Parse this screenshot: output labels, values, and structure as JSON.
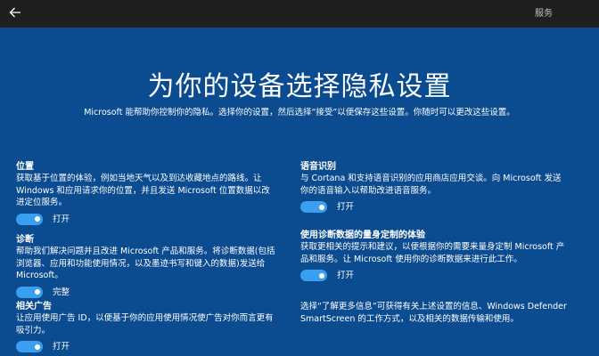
{
  "titlebar": {
    "back_icon": "back-arrow-icon",
    "service_label": "服务"
  },
  "header": {
    "title": "为你的设备选择隐私设置",
    "subtitle": "Microsoft 能帮助你控制你的隐私。选择你的设置，然后选择“接受”以便保存这些设置。你随时可以更改这些设置。"
  },
  "left": [
    {
      "title": "位置",
      "desc": "获取基于位置的体验，例如当地天气以及到达收藏地点的路线。让 Windows 和应用请求你的位置，并且发送 Microsoft 位置数据以改进定位服务。",
      "toggle_label": "打开",
      "on": true
    },
    {
      "title": "诊断",
      "desc": "帮助我们解决问题并且改进 Microsoft 产品和服务。将诊断数据(包括浏览器、应用和功能使用情况，以及墨迹书写和键入的数据)发送给 Microsoft。",
      "toggle_label": "完整",
      "on": true
    },
    {
      "title": "相关广告",
      "desc": "让应用使用广告 ID，以便基于你的应用使用情况使广告对你而言更有吸引力。",
      "toggle_label": "打开",
      "on": true
    }
  ],
  "right": [
    {
      "title": "语音识别",
      "desc": "与 Cortana 和支持语音识别的应用商店应用交谈。向 Microsoft 发送你的语音输入以帮助改进语音服务。",
      "toggle_label": "打开",
      "on": true
    },
    {
      "title": "使用诊断数据的量身定制的体验",
      "desc": "获取更相关的提示和建议，以便根据你的需要来量身定制 Microsoft 产品和服务。让 Microsoft 使用你的诊断数据来进行此工作。",
      "toggle_label": "打开",
      "on": true
    }
  ],
  "footer_note": "选择“了解更多信息”可获得有关上述设置的信息、Windows Defender SmartScreen 的工作方式，以及相关的数据传输和使用。",
  "colors": {
    "background": "#0b4b8f",
    "titlebar": "#1f1f1f",
    "toggle_on": "#3a9ff0"
  }
}
